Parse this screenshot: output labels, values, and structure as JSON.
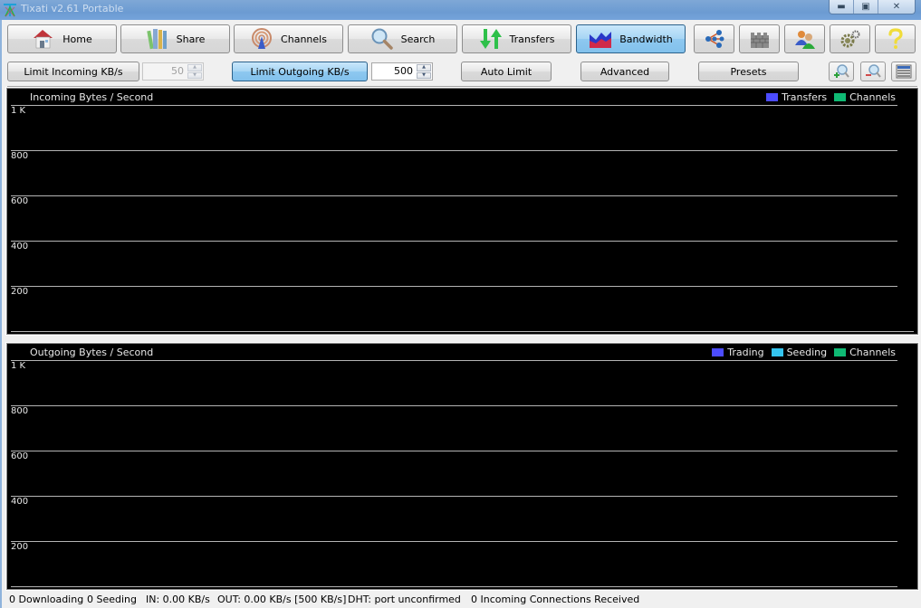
{
  "window": {
    "title": "Tixati v2.61 Portable",
    "controls": {
      "minimize": "minimize-icon",
      "maximize": "maximize-icon",
      "close": "close-icon"
    }
  },
  "nav": {
    "items": [
      {
        "label": "Home",
        "icon": "home-icon",
        "active": false
      },
      {
        "label": "Share",
        "icon": "books-icon",
        "active": false
      },
      {
        "label": "Channels",
        "icon": "broadcast-icon",
        "active": false
      },
      {
        "label": "Search",
        "icon": "magnifier-icon",
        "active": false
      },
      {
        "label": "Transfers",
        "icon": "up-down-arrows-icon",
        "active": false
      },
      {
        "label": "Bandwidth",
        "icon": "bandwidth-graph-icon",
        "active": true
      }
    ],
    "icon_buttons": [
      "network-nodes-icon",
      "firewall-icon",
      "users-icon",
      "gears-icon",
      "help-icon"
    ]
  },
  "controls": {
    "limit_incoming_label": "Limit Incoming KB/s",
    "limit_incoming_value": "50",
    "limit_incoming_enabled": false,
    "limit_outgoing_label": "Limit Outgoing KB/s",
    "limit_outgoing_value": "500",
    "limit_outgoing_enabled": true,
    "auto_limit_label": "Auto Limit",
    "advanced_label": "Advanced",
    "presets_label": "Presets",
    "zoom_in_icon": "zoom-in-icon",
    "zoom_out_icon": "zoom-out-icon",
    "layout_icon": "layout-icon"
  },
  "chart_data": [
    {
      "type": "area",
      "title": "Incoming Bytes / Second",
      "ylabel": "",
      "xlabel": "",
      "yticks": [
        "1 K",
        "800",
        "600",
        "400",
        "200"
      ],
      "ylim": [
        0,
        1000
      ],
      "grid": true,
      "legend_position": "top-right",
      "series": [
        {
          "name": "Transfers",
          "color": "#4c4cff",
          "values": []
        },
        {
          "name": "Channels",
          "color": "#0fba74",
          "values": []
        }
      ]
    },
    {
      "type": "area",
      "title": "Outgoing Bytes / Second",
      "ylabel": "",
      "xlabel": "",
      "yticks": [
        "1 K",
        "800",
        "600",
        "400",
        "200"
      ],
      "ylim": [
        0,
        1000
      ],
      "grid": true,
      "legend_position": "top-right",
      "series": [
        {
          "name": "Trading",
          "color": "#4c4cff",
          "values": []
        },
        {
          "name": "Seeding",
          "color": "#34c4ef",
          "values": []
        },
        {
          "name": "Channels",
          "color": "#0fba74",
          "values": []
        }
      ]
    }
  ],
  "status": {
    "downloading": "0 Downloading",
    "seeding": "0 Seeding",
    "in_rate": "IN: 0.00 KB/s",
    "out_rate": "OUT: 0.00 KB/s [500 KB/s]",
    "dht": "DHT: port unconfirmed",
    "incoming_connections": "0 Incoming Connections Received"
  }
}
